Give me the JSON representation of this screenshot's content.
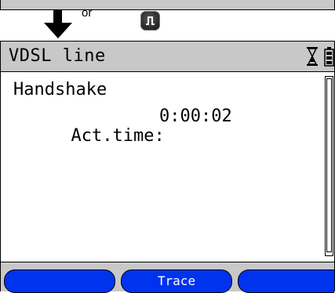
{
  "instruction": {
    "or_label": "or",
    "arrow_icon": "down-arrow-icon",
    "key_icon": "pulse-key-icon"
  },
  "screen": {
    "title": "VDSL line",
    "status_icons": [
      "hourglass-icon",
      "battery-icon"
    ],
    "lines": {
      "status": "Handshake",
      "act_time_label": "Act.time:",
      "act_time_value": "0:00:02"
    },
    "softkeys": {
      "left": "",
      "middle": "Trace",
      "right": ""
    }
  },
  "colors": {
    "titlebar": "#c8c8c8",
    "softkey": "#0033ee"
  }
}
